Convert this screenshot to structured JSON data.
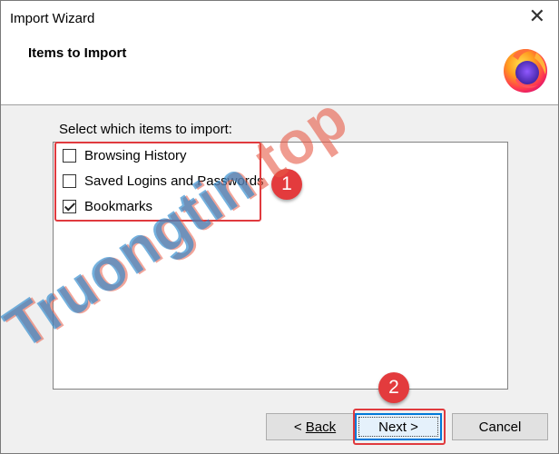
{
  "window": {
    "title": "Import Wizard",
    "close_glyph": "✕"
  },
  "header": {
    "title": "Items to Import",
    "logo": "firefox-logo"
  },
  "instruction": "Select which items to import:",
  "items": [
    {
      "label": "Browsing History",
      "checked": false
    },
    {
      "label": "Saved Logins and Passwords",
      "checked": false
    },
    {
      "label": "Bookmarks",
      "checked": true
    }
  ],
  "annotations": {
    "badge1": "1",
    "badge2": "2"
  },
  "buttons": {
    "back": "Back",
    "back_prefix": "< ",
    "next": "Next >",
    "cancel": "Cancel"
  },
  "watermark": {
    "name": "Truongtin",
    "tld": ".top"
  },
  "colors": {
    "highlight": "#e03a3e",
    "accent": "#0078d7"
  }
}
